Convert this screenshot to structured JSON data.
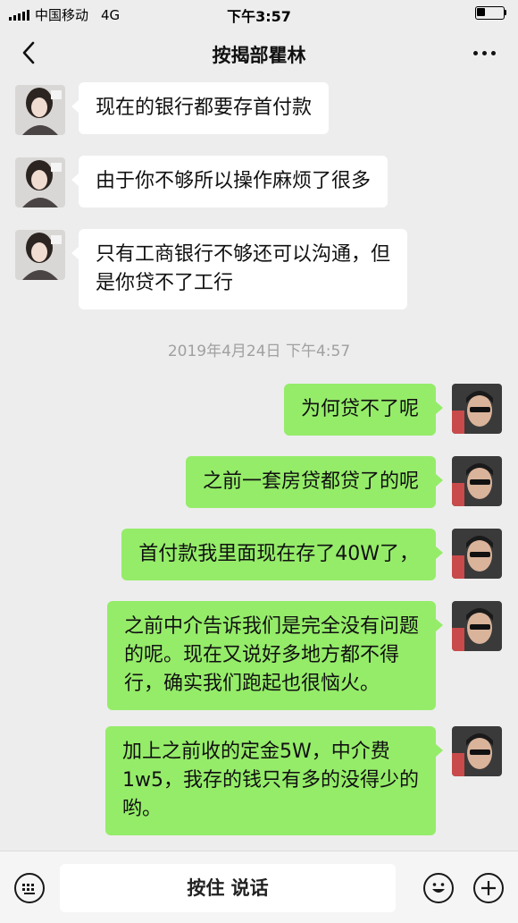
{
  "status_bar": {
    "carrier": "中国移动",
    "network": "4G",
    "time": "下午3:57"
  },
  "header": {
    "title": "按揭部瞿林",
    "back_icon": "chevron-left-icon",
    "more_icon": "more-dots-icon"
  },
  "messages": [
    {
      "sender": "other",
      "lines": [
        "现在的银行都要存首付款"
      ]
    },
    {
      "sender": "other",
      "lines": [
        "由于你不够所以操作麻烦了很多"
      ]
    },
    {
      "sender": "other",
      "lines": [
        "只有工商银行不够还可以沟通，但",
        "是你贷不了工行"
      ]
    },
    {
      "sender": "me",
      "lines": [
        "为何贷不了呢"
      ]
    },
    {
      "sender": "me",
      "lines": [
        "之前一套房贷都贷了的呢"
      ]
    },
    {
      "sender": "me",
      "lines": [
        "首付款我里面现在存了40W了，"
      ]
    },
    {
      "sender": "me",
      "lines": [
        "之前中介告诉我们是完全没有问题",
        "的呢。现在又说好多地方都不得",
        "行，确实我们跑起也很恼火。"
      ]
    },
    {
      "sender": "me",
      "lines": [
        "加上之前收的定金5W，中介费",
        "1w5，我存的钱只有多的没得少的",
        "哟。"
      ]
    }
  ],
  "timestamp": "2019年4月24日 下午4:57",
  "input_bar": {
    "hold_to_talk_label": "按住 说话",
    "keyboard_icon": "keyboard-icon",
    "emoji_icon": "emoji-icon",
    "plus_icon": "plus-icon"
  },
  "colors": {
    "background": "#ededed",
    "incoming_bubble": "#ffffff",
    "outgoing_bubble": "#95ec69",
    "timestamp_text": "#a0a0a0"
  }
}
